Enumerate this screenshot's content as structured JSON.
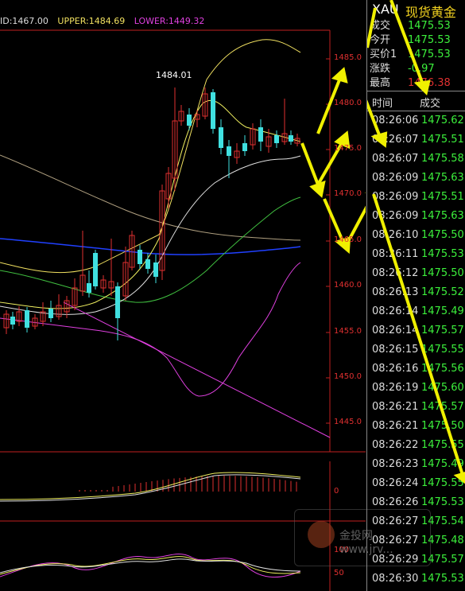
{
  "legend": {
    "mid": "ID:1467.00",
    "upper": "UPPER:1484.69",
    "lower": "LOWER:1449.32"
  },
  "high_marker": "1484.01",
  "price_axis": [
    "1485.0",
    "1480.0",
    "1475.0",
    "1470.0",
    "1465.0",
    "1460.0",
    "1455.0",
    "1450.0",
    "1445.0"
  ],
  "macd_axis": [
    "0"
  ],
  "kdj_axis": [
    "100",
    "50"
  ],
  "colors": {
    "up_candle": "#e03030",
    "down_candle": "#40e0e0",
    "upper_band": "#f0e060",
    "lower_band": "#e040e0",
    "annotation_arrow": "#f0f000",
    "tick_price": "#3cf03c"
  },
  "quote": {
    "symbol": "XAU",
    "title": "现货黄金",
    "rows": [
      {
        "label": "成交",
        "value": "1475.53",
        "color": "#3cf03c"
      },
      {
        "label": "今开",
        "value": "1475.53",
        "color": "#3cf03c"
      },
      {
        "label": "买价1",
        "value": "1475.53",
        "color": "#3cf03c"
      },
      {
        "label": "涨跌",
        "value": "-0.97",
        "color": "#3cf03c"
      },
      {
        "label": "最高",
        "value": "1476.38",
        "color": "#e03030"
      }
    ]
  },
  "ticks": {
    "time_header": "时间",
    "price_header": "成交",
    "rows": [
      {
        "time": "08:26:06",
        "price": "1475.62"
      },
      {
        "time": "08:26:07",
        "price": "1475.51"
      },
      {
        "time": "08:26:07",
        "price": "1475.58"
      },
      {
        "time": "08:26:09",
        "price": "1475.63"
      },
      {
        "time": "08:26:09",
        "price": "1475.51"
      },
      {
        "time": "08:26:09",
        "price": "1475.63"
      },
      {
        "time": "08:26:10",
        "price": "1475.50"
      },
      {
        "time": "08:26:11",
        "price": "1475.53"
      },
      {
        "time": "08:26:12",
        "price": "1475.50"
      },
      {
        "time": "08:26:13",
        "price": "1475.52"
      },
      {
        "time": "08:26:14",
        "price": "1475.49"
      },
      {
        "time": "08:26:14",
        "price": "1475.57"
      },
      {
        "time": "08:26:15",
        "price": "1475.55"
      },
      {
        "time": "08:26:16",
        "price": "1475.56"
      },
      {
        "time": "08:26:19",
        "price": "1475.60"
      },
      {
        "time": "08:26:21",
        "price": "1475.57"
      },
      {
        "time": "08:26:21",
        "price": "1475.50"
      },
      {
        "time": "08:26:22",
        "price": "1475.55"
      },
      {
        "time": "08:26:23",
        "price": "1475.49"
      },
      {
        "time": "08:26:24",
        "price": "1475.55"
      },
      {
        "time": "08:26:26",
        "price": "1475.53"
      },
      {
        "time": "08:26:27",
        "price": "1475.54"
      },
      {
        "time": "08:26:27",
        "price": "1475.48"
      },
      {
        "time": "08:26:29",
        "price": "1475.57"
      },
      {
        "time": "08:26:30",
        "price": "1475.53"
      }
    ]
  },
  "watermark": "金投网 www.jrv..."
}
